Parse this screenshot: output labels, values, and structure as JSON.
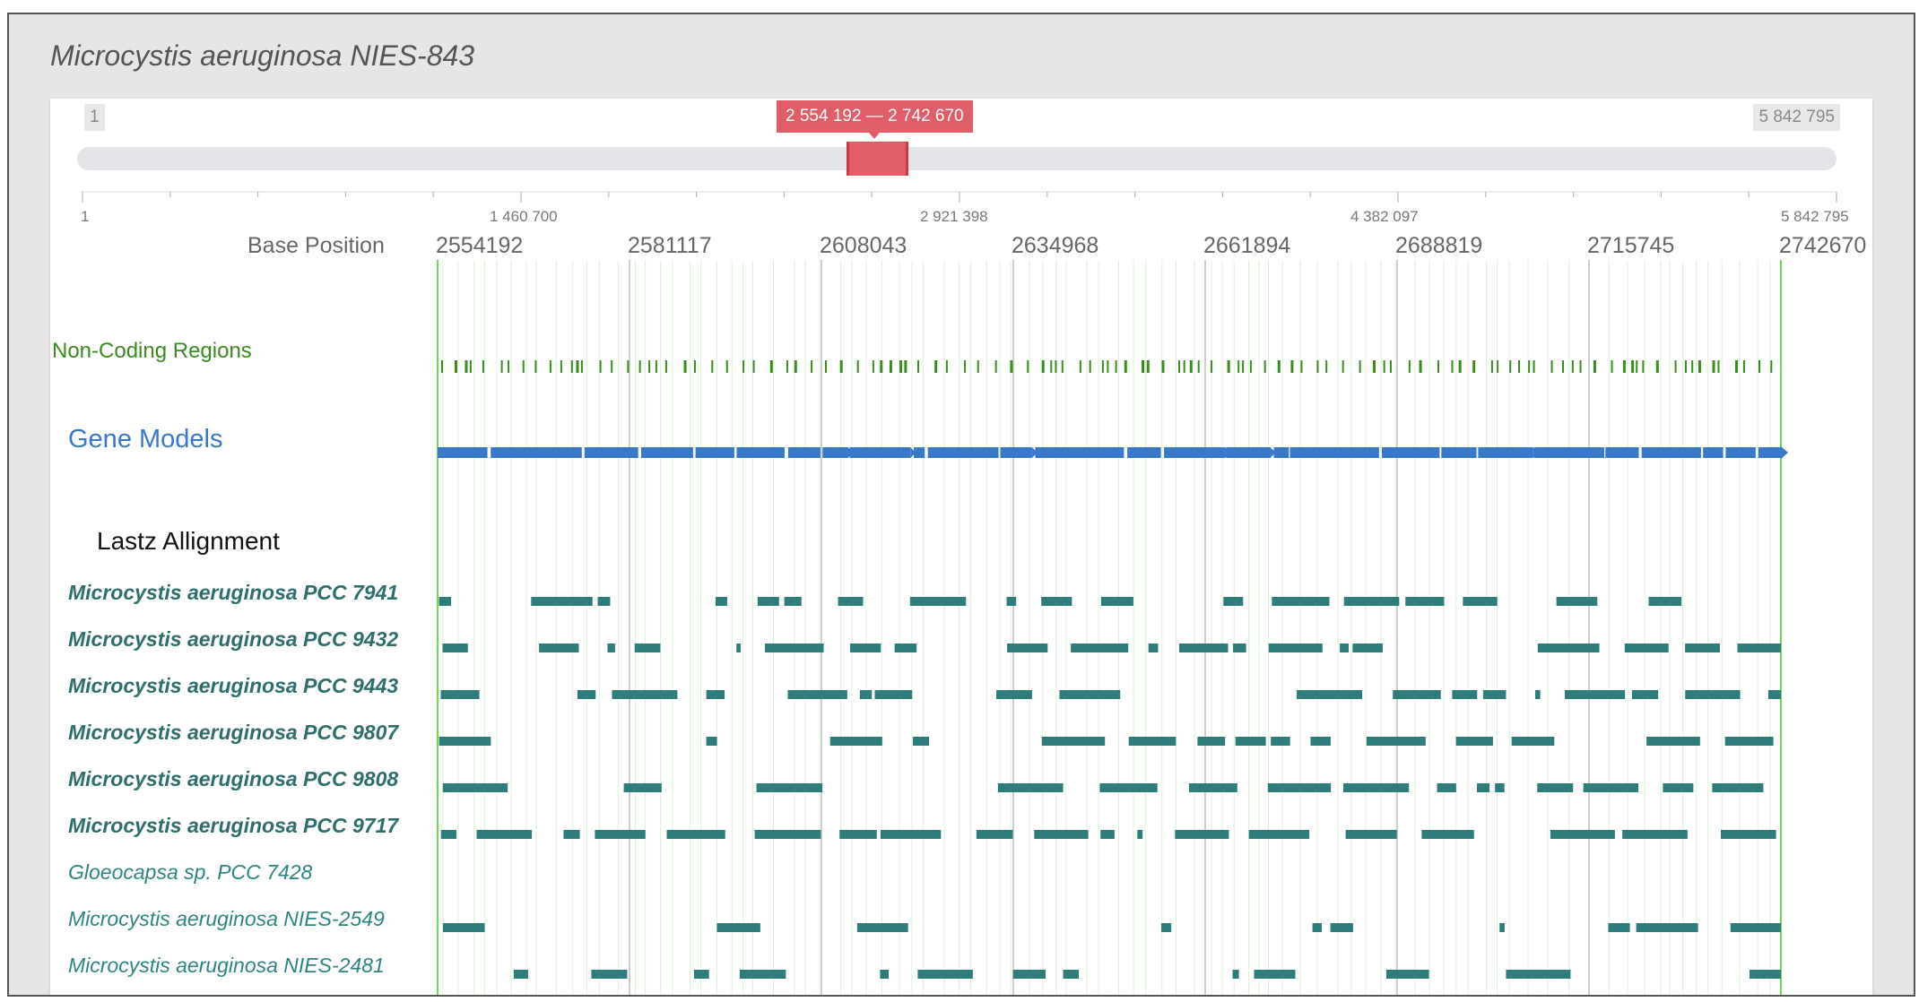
{
  "title": "Microcystis aeruginosa NIES-843",
  "range": {
    "start_box": "1",
    "end_box": "5 842 795",
    "selected_label": "2 554 192 — 2 742 670",
    "selected_start": 2554192,
    "selected_end": 2742670,
    "genome_length": 5842795
  },
  "overview_ticks": [
    "1",
    "1 460 700",
    "2 921 398",
    "4 382 097",
    "5 842 795"
  ],
  "base_position": {
    "label": "Base Position",
    "ticks": [
      "2554192",
      "2581117",
      "2608043",
      "2634968",
      "2661894",
      "2688819",
      "2715745",
      "2742670"
    ]
  },
  "tracks": {
    "noncoding_label": "Non-Coding Regions",
    "gene_models_label": "Gene Models",
    "lastz_label": "Lastz Allignment",
    "alignments": [
      "Microcystis aeruginosa PCC 7941",
      "Microcystis aeruginosa PCC 9432",
      "Microcystis aeruginosa PCC 9443",
      "Microcystis aeruginosa PCC 9807",
      "Microcystis aeruginosa PCC 9808",
      "Microcystis aeruginosa PCC 9717",
      "Gloeocapsa sp. PCC 7428",
      "Microcystis aeruginosa NIES-2549",
      "Microcystis aeruginosa NIES-2481"
    ]
  },
  "colors": {
    "accent": "#e15d67",
    "noncoding": "#3a8c1f",
    "gene": "#3a79c9",
    "alignment": "#2e7d7a",
    "edge_line": "#66e04a"
  }
}
